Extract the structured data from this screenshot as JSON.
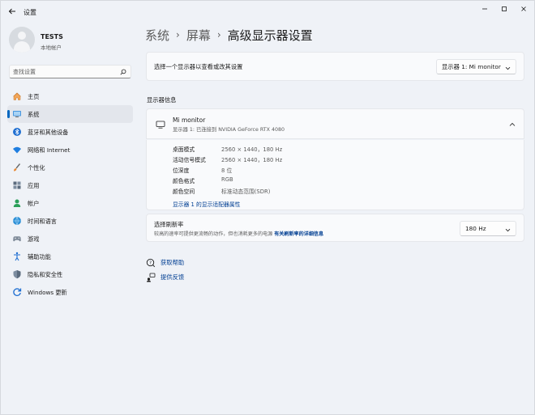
{
  "window": {
    "title": "设置"
  },
  "profile": {
    "name": "TESTS",
    "account_type": "本地帐户"
  },
  "search": {
    "placeholder": "查找设置"
  },
  "sidebar": {
    "items": [
      {
        "label": "主页",
        "icon": "home-icon"
      },
      {
        "label": "系统",
        "icon": "system-icon",
        "active": true
      },
      {
        "label": "蓝牙和其他设备",
        "icon": "bluetooth-icon"
      },
      {
        "label": "网络和 Internet",
        "icon": "wifi-icon"
      },
      {
        "label": "个性化",
        "icon": "brush-icon"
      },
      {
        "label": "应用",
        "icon": "apps-icon"
      },
      {
        "label": "帐户",
        "icon": "person-icon"
      },
      {
        "label": "时间和语言",
        "icon": "globe-clock-icon"
      },
      {
        "label": "游戏",
        "icon": "gamepad-icon"
      },
      {
        "label": "辅助功能",
        "icon": "accessibility-icon"
      },
      {
        "label": "隐私和安全性",
        "icon": "shield-icon"
      },
      {
        "label": "Windows 更新",
        "icon": "update-icon"
      }
    ]
  },
  "breadcrumb": {
    "items": [
      "系统",
      "屏幕"
    ],
    "current": "高级显示器设置"
  },
  "select_display": {
    "label": "选择一个显示器以查看或改其设置",
    "dropdown_value": "显示器 1: Mi monitor"
  },
  "display_info": {
    "section_title": "显示器信息",
    "monitor_name": "Mi monitor",
    "monitor_subtitle": "显示器 1: 已连接到 NVIDIA GeForce RTX 4080",
    "details": [
      {
        "key": "桌面模式",
        "value": "2560 × 1440，180 Hz"
      },
      {
        "key": "活动信号模式",
        "value": "2560 × 1440，180 Hz"
      },
      {
        "key": "位深度",
        "value": "8 位"
      },
      {
        "key": "颜色格式",
        "value": "RGB"
      },
      {
        "key": "颜色空间",
        "value": "标准动态范围(SDR)"
      }
    ],
    "adapter_link": "显示器 1 的显示适配器属性"
  },
  "refresh_rate": {
    "title": "选择刷新率",
    "description": "较高的速率可提供更流畅的动作，但也消耗更多的电源  ",
    "more_link": "有关刷新率的详细信息",
    "dropdown_value": "180 Hz"
  },
  "help": {
    "get_help": "获取帮助",
    "feedback": "提供反馈"
  },
  "colors": {
    "accent": "#0067c0",
    "link": "#003e92",
    "background": "#eff2f7",
    "card": "#f9fafc"
  }
}
